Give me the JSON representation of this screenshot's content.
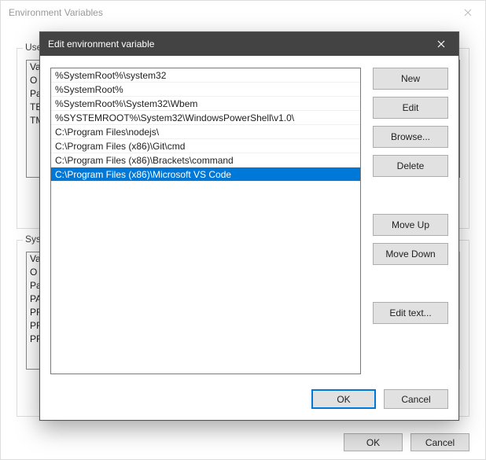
{
  "parent": {
    "title": "Environment Variables",
    "user_group_label": "User",
    "system_group_label": "Syste",
    "user_vars": [
      "Va",
      "O",
      "Pa",
      "TE",
      "TM"
    ],
    "system_vars": [
      "Va",
      "O",
      "Pa",
      "PA",
      "PR",
      "PR",
      "PR"
    ],
    "ok_label": "OK",
    "cancel_label": "Cancel"
  },
  "edit": {
    "title": "Edit environment variable",
    "paths": [
      "%SystemRoot%\\system32",
      "%SystemRoot%",
      "%SystemRoot%\\System32\\Wbem",
      "%SYSTEMROOT%\\System32\\WindowsPowerShell\\v1.0\\",
      "C:\\Program Files\\nodejs\\",
      "C:\\Program Files (x86)\\Git\\cmd",
      "C:\\Program Files (x86)\\Brackets\\command",
      "C:\\Program Files (x86)\\Microsoft VS Code"
    ],
    "selected_index": 7,
    "buttons": {
      "new": "New",
      "edit": "Edit",
      "browse": "Browse...",
      "delete": "Delete",
      "move_up": "Move Up",
      "move_down": "Move Down",
      "edit_text": "Edit text...",
      "ok": "OK",
      "cancel": "Cancel"
    }
  }
}
